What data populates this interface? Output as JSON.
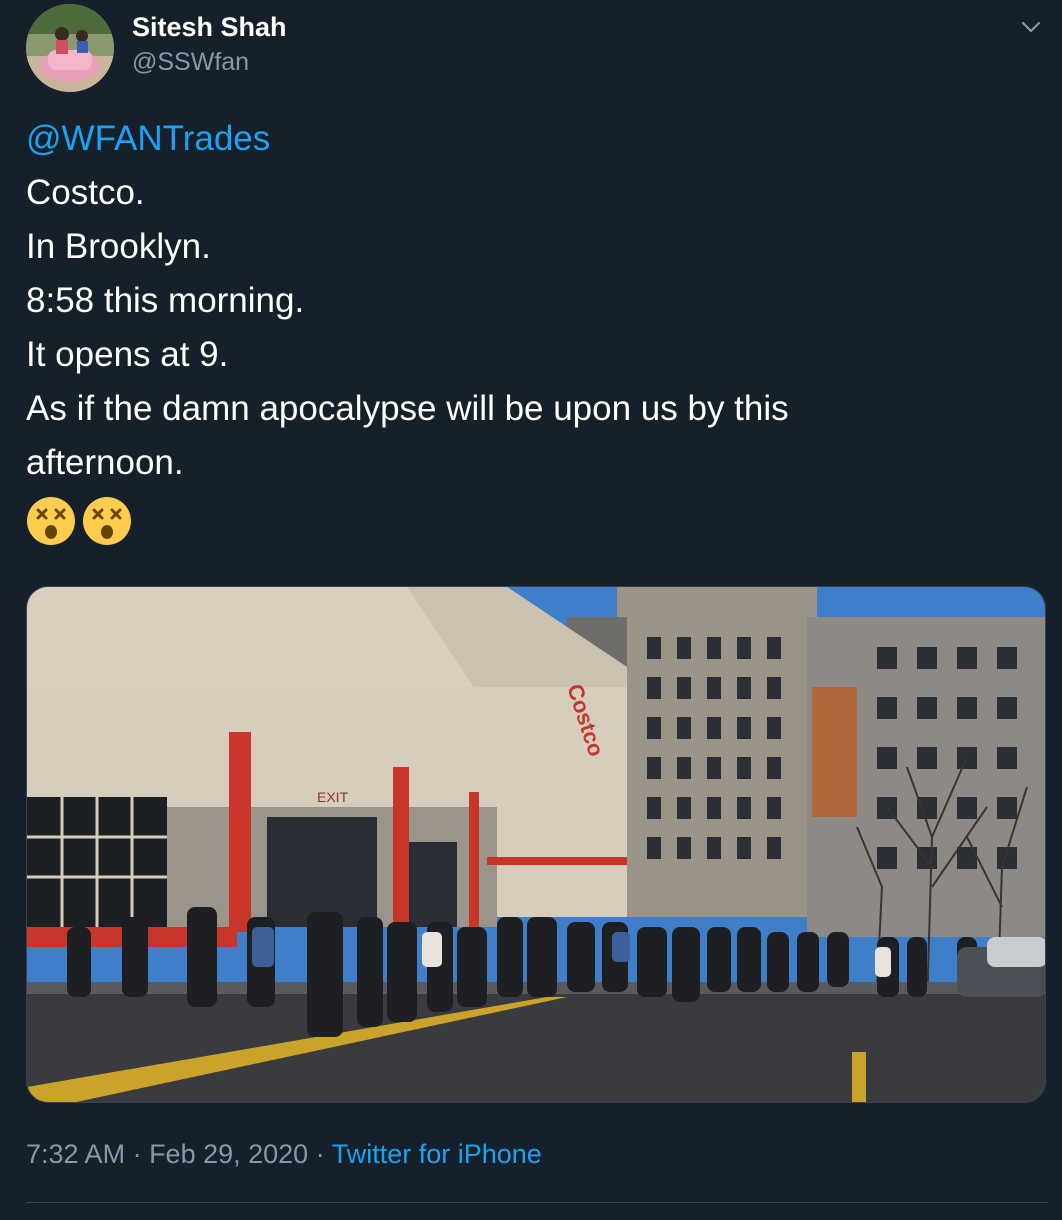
{
  "author": {
    "display_name": "Sitesh Shah",
    "handle": "@SSWfan"
  },
  "tweet": {
    "mention": "@WFANTrades",
    "lines": [
      "Costco.",
      "In Brooklyn.",
      "8:58 this morning.",
      "It opens at 9.",
      "As if the damn apocalypse will be upon us by this",
      "afternoon."
    ],
    "emojis": [
      "dizzy-face-icon",
      "dizzy-face-icon"
    ]
  },
  "media": {
    "photo_signage": {
      "store_sign": "Costco",
      "exit_sign": "EXIT"
    }
  },
  "meta": {
    "time": "7:32 AM",
    "separator": " · ",
    "date": "Feb 29, 2020",
    "source": "Twitter for iPhone"
  },
  "colors": {
    "background": "#15202b",
    "link": "#1da1f2",
    "secondary_text": "#8899a6",
    "border": "#38444d"
  }
}
